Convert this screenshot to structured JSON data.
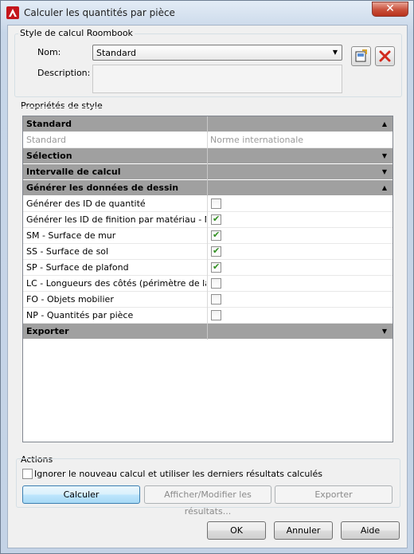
{
  "window": {
    "title": "Calculer les quantités par pièce",
    "close_label": "✕"
  },
  "style_group": {
    "label": "Style de calcul Roombook",
    "name_label": "Nom:",
    "name_value": "Standard",
    "description_label": "Description:"
  },
  "properties": {
    "label": "Propriétés de style",
    "rows": [
      {
        "name": "Standard",
        "type": "category",
        "toggle": "▲"
      },
      {
        "name": "Standard",
        "type": "disabled",
        "value": "Norme internationale"
      },
      {
        "name": "Sélection",
        "type": "category",
        "toggle": "▼"
      },
      {
        "name": "Intervalle de calcul",
        "type": "category",
        "toggle": "▼"
      },
      {
        "name": "Générer les données de dessin",
        "type": "category",
        "toggle": "▲"
      },
      {
        "name": "Générer des ID de quantité",
        "type": "check",
        "checked": false
      },
      {
        "name": "Générer les ID de finition par matériau - Nom",
        "type": "check",
        "checked": true
      },
      {
        "name": "SM - Surface de mur",
        "type": "check",
        "checked": true
      },
      {
        "name": "SS - Surface de sol",
        "type": "check",
        "checked": true
      },
      {
        "name": "SP - Surface de plafond",
        "type": "check",
        "checked": true
      },
      {
        "name": "LC - Longueurs des côtés (périmètre de la pièce)",
        "type": "check",
        "checked": false
      },
      {
        "name": "FO - Objets mobilier",
        "type": "check",
        "checked": false
      },
      {
        "name": "NP - Quantités par pièce",
        "type": "check",
        "checked": false
      },
      {
        "name": "Exporter",
        "type": "category",
        "toggle": "▼"
      }
    ]
  },
  "actions": {
    "label": "Actions",
    "ignore_label": "Ignorer le nouveau calcul et utiliser les derniers résultats calculés",
    "calculate": "Calculer",
    "show_modify": "Afficher/Modifier les résultats...",
    "export": "Exporter"
  },
  "footer": {
    "ok": "OK",
    "cancel": "Annuler",
    "help": "Aide"
  }
}
